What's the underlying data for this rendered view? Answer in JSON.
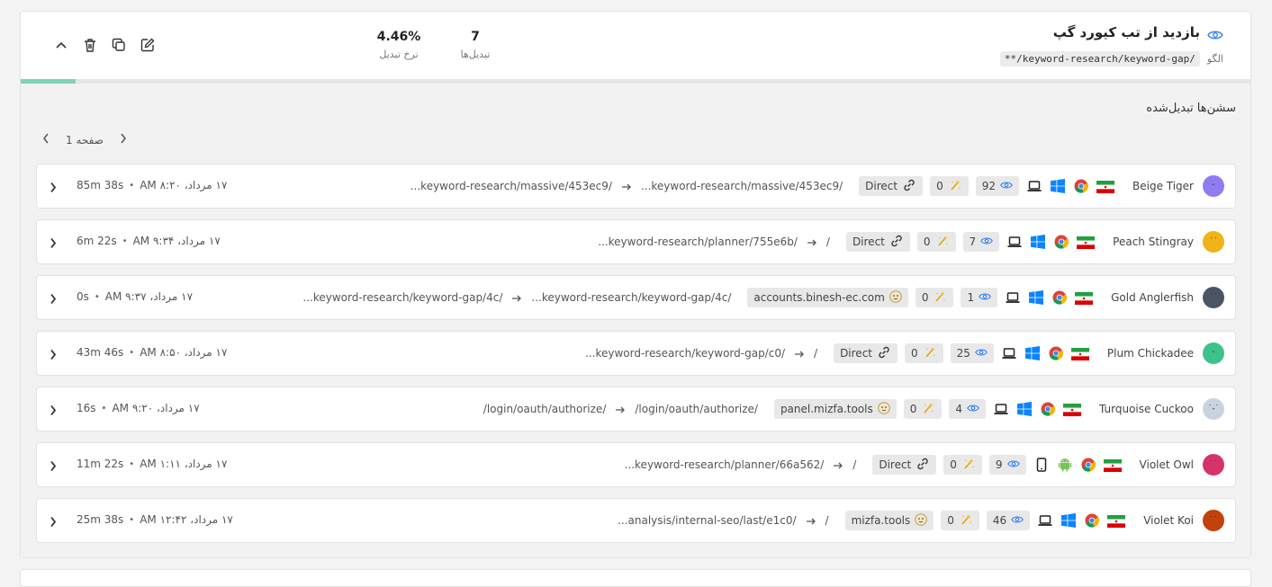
{
  "goal": {
    "title": "بازدید از تب کیورد گپ",
    "pattern_label": "الگو",
    "pattern_value": "**/keyword-research/keyword-gap/",
    "conversions_value": "7",
    "conversions_label": "تبدیل‌ها",
    "rate_value": "4.46%",
    "rate_label": "نرخ تبدیل",
    "progress_fraction": 0.0446
  },
  "sessions": {
    "title": "سشن‌ها تبدیل‌شده",
    "page_label": "صفحه 1"
  },
  "rows": [
    {
      "name": "Beige Tiger",
      "avatar_color": "#8e7cf0",
      "face": "ᵕ",
      "device": "laptop",
      "os": "windows",
      "views": "92",
      "events": "0",
      "source": "Direct",
      "source_type": "direct",
      "entry": "...keyword-research/massive/453ec9/",
      "exit": "...keyword-research/massive/453ec9/",
      "date": "۱۷ مرداد، AM ۸:۲۰",
      "duration": "85m 38s"
    },
    {
      "name": "Peach Stingray",
      "avatar_color": "#f0b418",
      "face": "˙˙",
      "device": "laptop",
      "os": "windows",
      "views": "7",
      "events": "0",
      "source": "Direct",
      "source_type": "direct",
      "entry": "/",
      "exit": "...keyword-research/planner/755e6b/",
      "date": "۱۷ مرداد، AM ۹:۳۴",
      "duration": "6m 22s"
    },
    {
      "name": "Gold Anglerfish",
      "avatar_color": "#4b5563",
      "face": "˙˙",
      "device": "laptop",
      "os": "windows",
      "views": "1",
      "events": "0",
      "source": "accounts.binesh-ec.com",
      "source_type": "site",
      "entry": "...keyword-research/keyword-gap/4c/",
      "exit": "...keyword-research/keyword-gap/4c/",
      "date": "۱۷ مرداد، AM ۹:۳۷",
      "duration": "0s"
    },
    {
      "name": "Plum Chickadee",
      "avatar_color": "#3ec28b",
      "face": "ᵕ",
      "device": "laptop",
      "os": "windows",
      "views": "25",
      "events": "0",
      "source": "Direct",
      "source_type": "direct",
      "entry": "/",
      "exit": "...keyword-research/keyword-gap/c0/",
      "date": "۱۷ مرداد، AM ۸:۵۰",
      "duration": "43m 46s"
    },
    {
      "name": "Turquoise Cuckoo",
      "avatar_color": "#c9d3e0",
      "face": "˙-˙",
      "device": "laptop",
      "os": "windows",
      "views": "4",
      "events": "0",
      "source": "panel.mizfa.tools",
      "source_type": "site",
      "entry": "/login/oauth/authorize/",
      "exit": "/login/oauth/authorize/",
      "date": "۱۷ مرداد، AM ۹:۲۰",
      "duration": "16s"
    },
    {
      "name": "Violet Owl",
      "avatar_color": "#d6336c",
      "face": "˙˙",
      "device": "mobile",
      "os": "android",
      "views": "9",
      "events": "0",
      "source": "Direct",
      "source_type": "direct",
      "entry": "/",
      "exit": "...keyword-research/planner/66a562/",
      "date": "۱۷ مرداد، AM ۱:۱۱",
      "duration": "11m 22s"
    },
    {
      "name": "Violet Koi",
      "avatar_color": "#c2410c",
      "face": "˙˙",
      "device": "laptop",
      "os": "windows",
      "views": "46",
      "events": "0",
      "source": "mizfa.tools",
      "source_type": "site",
      "entry": "/",
      "exit": "...analysis/internal-seo/last/e1c0/",
      "date": "۱۷ مرداد، AM ۱۲:۴۲",
      "duration": "25m 38s"
    }
  ],
  "icons": {
    "eye": "eye-icon",
    "edit": "edit-icon",
    "copy": "copy-icon",
    "delete": "trash-icon",
    "collapse": "chevron-up-icon",
    "direct": "link-icon",
    "site": "site-favicon-icon",
    "events": "spark-icon"
  },
  "colors": {
    "accent": "#3b82f6",
    "progress": "#7ed3b2"
  }
}
